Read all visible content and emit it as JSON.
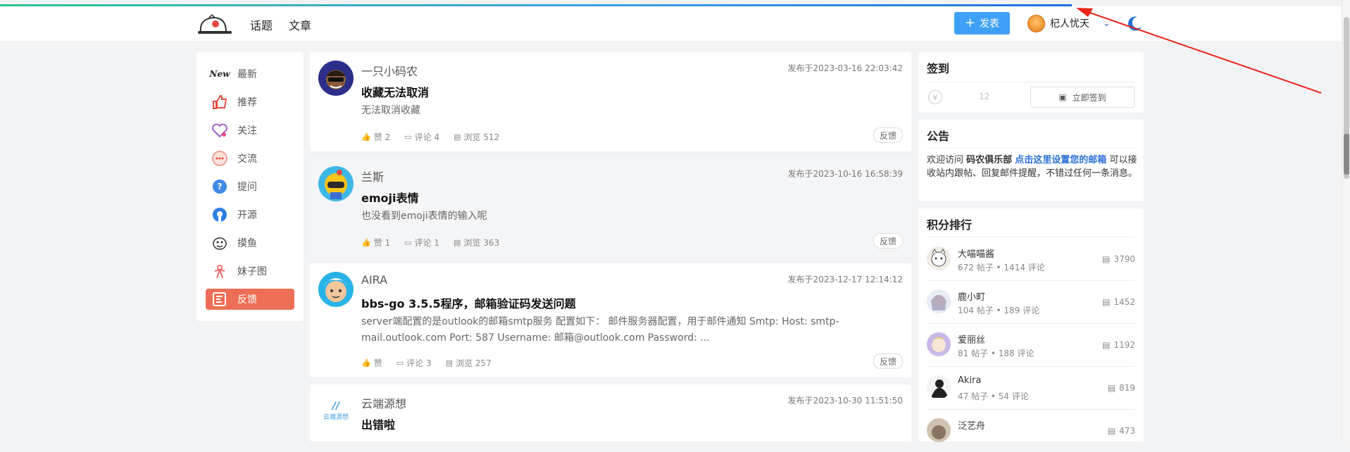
{
  "header": {
    "nav": [
      {
        "label": "话题"
      },
      {
        "label": "文章"
      }
    ],
    "post_button": "发表",
    "username": "杞人忧天"
  },
  "sidebar": {
    "items": [
      {
        "label": "最新",
        "icon": "new-icon"
      },
      {
        "label": "推荐",
        "icon": "thumb-up-icon"
      },
      {
        "label": "关注",
        "icon": "heart-icon"
      },
      {
        "label": "交流",
        "icon": "chat-icon"
      },
      {
        "label": "提问",
        "icon": "question-icon"
      },
      {
        "label": "开源",
        "icon": "open-source-icon"
      },
      {
        "label": "摸鱼",
        "icon": "fish-icon"
      },
      {
        "label": "妹子图",
        "icon": "girl-icon"
      },
      {
        "label": "反馈",
        "icon": "feedback-icon",
        "active": true
      }
    ]
  },
  "topics": [
    {
      "author": "一只小码农",
      "time": "发布于2023-03-16 22:03:42",
      "title": "收藏无法取消",
      "summary": "无法取消收藏",
      "likes": "赞 2",
      "comments": "评论 4",
      "views": "浏览 512",
      "tag": "反馈"
    },
    {
      "author": "兰斯",
      "time": "发布于2023-10-16 16:58:39",
      "title": "emoji表情",
      "summary": "也没看到emoji表情的输入呢",
      "likes": "赞 1",
      "comments": "评论 1",
      "views": "浏览 363",
      "tag": "反馈"
    },
    {
      "author": "AIRA",
      "time": "发布于2023-12-17 12:14:12",
      "title": "bbs-go 3.5.5程序，邮箱验证码发送问题",
      "summary": "server端配置的是outlook的邮箱smtp服务 配置如下：  邮件服务器配置，用于邮件通知 Smtp: Host: smtp-mail.outlook.com Port: 587 Username: 邮箱@outlook.com Password: ...",
      "likes": "赞",
      "comments": "评论 3",
      "views": "浏览 257",
      "tag": "反馈"
    },
    {
      "author": "云端源想",
      "time": "发布于2023-10-30 11:51:50",
      "title": "出错啦",
      "logo_text": "云端源想"
    }
  ],
  "checkin": {
    "title": "签到",
    "coin_symbol": "¥",
    "count": "12",
    "button": "立即签到"
  },
  "notice": {
    "title": "公告",
    "prefix": "欢迎访问 ",
    "site": "码农俱乐部",
    "link": "点击这里设置您的邮箱",
    "suffix": " 可以接收站内跟帖、回复邮件提醒，不错过任何一条消息。"
  },
  "ranking": {
    "title": "积分排行",
    "rows": [
      {
        "name": "大喵喵酱",
        "stat": "672 帖子 • 1414 评论",
        "score": "3790"
      },
      {
        "name": "鹿小町",
        "stat": "104 帖子 • 189 评论",
        "score": "1452"
      },
      {
        "name": "爱丽丝",
        "stat": "81 帖子 • 188 评论",
        "score": "1192"
      },
      {
        "name": "Akira",
        "stat": "47 帖子 • 54 评论",
        "score": "819"
      },
      {
        "name": "泛艺舟",
        "stat": "",
        "score": "473"
      }
    ]
  },
  "colors": {
    "accent": "#3fa0f7",
    "active": "#ec6e55",
    "link": "#2a6fd6"
  }
}
